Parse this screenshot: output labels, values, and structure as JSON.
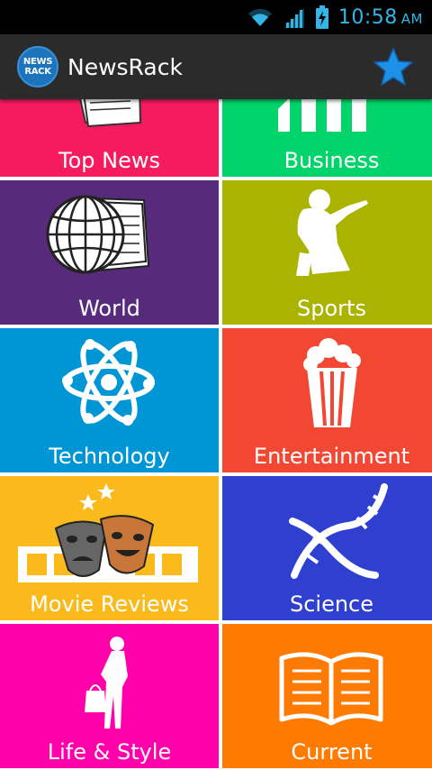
{
  "status_bar": {
    "time": "10:58",
    "ampm": "AM",
    "icons": [
      "wifi-icon",
      "signal-icon",
      "battery-charging-icon"
    ],
    "accent_color": "#33b5e5"
  },
  "action_bar": {
    "logo_line1": "NEWS",
    "logo_line2": "RACK",
    "title": "NewsRack",
    "favorite_icon": "star-icon",
    "star_color": "#1e90e8"
  },
  "categories": [
    {
      "label": "Top News",
      "color": "#f51b5e",
      "icon": "newspaper-icon"
    },
    {
      "label": "Business",
      "color": "#00d46a",
      "icon": "bar-chart-icon"
    },
    {
      "label": "World",
      "color": "#582a7c",
      "icon": "globe-icon"
    },
    {
      "label": "Sports",
      "color": "#aab300",
      "icon": "cricket-player-icon"
    },
    {
      "label": "Technology",
      "color": "#0096d6",
      "icon": "atom-icon"
    },
    {
      "label": "Entertainment",
      "color": "#f24733",
      "icon": "popcorn-icon"
    },
    {
      "label": "Movie Reviews",
      "color": "#fbba1c",
      "icon": "theater-masks-icon"
    },
    {
      "label": "Science",
      "color": "#2f3fd0",
      "icon": "dna-icon"
    },
    {
      "label": "Life & Style",
      "color": "#ff00aa",
      "icon": "shopping-woman-icon"
    },
    {
      "label": "Current",
      "color": "#ff7a00",
      "icon": "open-book-icon"
    }
  ]
}
